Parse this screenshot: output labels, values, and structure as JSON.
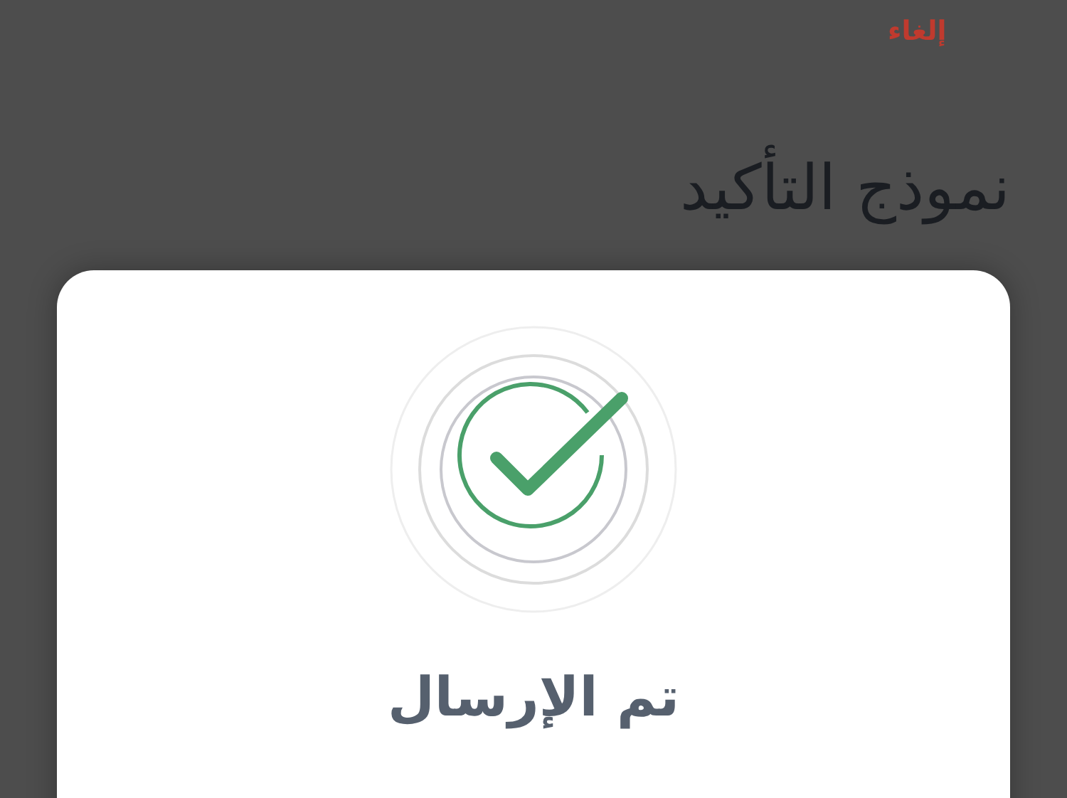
{
  "cancel_link": "إلغاء",
  "title": "نموذج التأكيد",
  "card": {
    "status_title": "تم الإرسال"
  }
}
